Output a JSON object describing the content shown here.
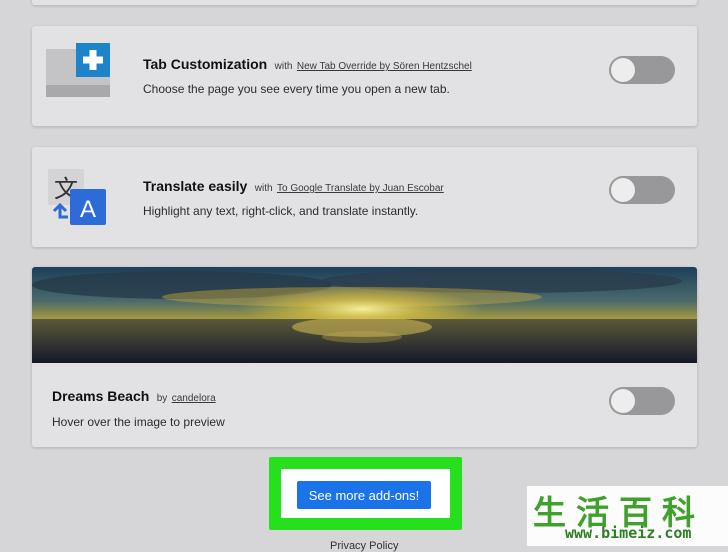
{
  "addons": [
    {
      "title": "Tab Customization",
      "with": "with",
      "author": "New Tab Override by Sören Hentzschel",
      "description": "Choose the page you see every time you open a new tab.",
      "icon": "tab-plus-icon",
      "enabled": false
    },
    {
      "title": "Translate easily",
      "with": "with",
      "author": "To Google Translate by Juan Escobar",
      "description": "Highlight any text, right-click, and translate instantly.",
      "icon": "translate-icon",
      "enabled": false
    }
  ],
  "theme": {
    "title": "Dreams Beach",
    "by": "by",
    "author": "candelora",
    "description": "Hover over the image to preview",
    "enabled": false
  },
  "see_more_label": "See more add-ons!",
  "privacy_label": "Privacy Policy",
  "watermark": {
    "chinese": "生活百科",
    "url": "www.bimeiz.com"
  },
  "colors": {
    "button_blue": "#1a73e8",
    "highlight_green": "#27e01d",
    "toggle_off": "#98989b",
    "watermark_green": "#3ea12c"
  }
}
